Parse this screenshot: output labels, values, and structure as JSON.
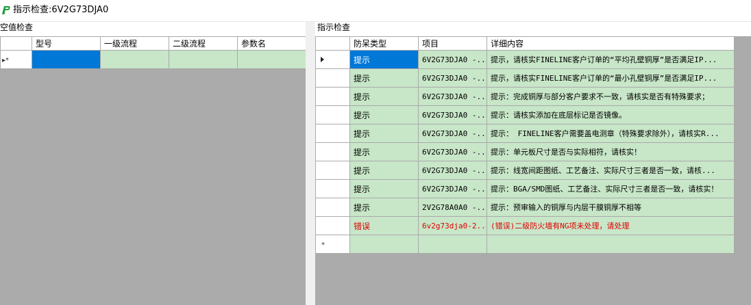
{
  "window": {
    "title": "指示检查:6V2G73DJA0"
  },
  "left_panel": {
    "label": "空值检查",
    "columns": [
      "型号",
      "一级流程",
      "二级流程",
      "参数名"
    ],
    "new_row_marker": "▸*"
  },
  "right_panel": {
    "label": "指示检查",
    "columns": [
      "防呆类型",
      "项目",
      "详细内容"
    ],
    "rows": [
      {
        "type": "提示",
        "item": "6V2G73DJA0 -...",
        "detail": "提示，请核实FINELINE客户订单的“平均孔壁铜厚”是否满足IP...",
        "error": false,
        "selected": true
      },
      {
        "type": "提示",
        "item": "6V2G73DJA0 -...",
        "detail": "提示，请核实FINELINE客户订单的“最小孔壁铜厚”是否满足IP...",
        "error": false,
        "selected": false
      },
      {
        "type": "提示",
        "item": "6V2G73DJA0 -...",
        "detail": "提示：完成铜厚与部分客户要求不一致，请核实是否有特殊要求；",
        "error": false,
        "selected": false
      },
      {
        "type": "提示",
        "item": "6V2G73DJA0 -...",
        "detail": "提示：请核实添加在底层标记是否镜像。",
        "error": false,
        "selected": false
      },
      {
        "type": "提示",
        "item": "6V2G73DJA0 -...",
        "detail": "提示： FINELINE客户需要盖电测章（特殊要求除外），请核实R...",
        "error": false,
        "selected": false
      },
      {
        "type": "提示",
        "item": "6V2G73DJA0 -...",
        "detail": "提示：单元板尺寸是否与实际相符，请核实！",
        "error": false,
        "selected": false
      },
      {
        "type": "提示",
        "item": "6V2G73DJA0 -...",
        "detail": "提示：线宽间距图纸、工艺备注、实际尺寸三者是否一致，请核...",
        "error": false,
        "selected": false
      },
      {
        "type": "提示",
        "item": "6V2G73DJA0 -...",
        "detail": "提示：BGA/SMD图纸、工艺备注、实际尺寸三者是否一致，请核实！",
        "error": false,
        "selected": false
      },
      {
        "type": "提示",
        "item": "2V2G78A0A0 -...",
        "detail": "提示：预审输入的铜厚与内层干膜铜厚不相等",
        "error": false,
        "selected": false
      },
      {
        "type": "错误",
        "item": "6v2g73dja0-2...",
        "detail": "(错误)二级防火墙有NG项未处理，请处理",
        "error": true,
        "selected": false
      }
    ],
    "new_row_marker": "*"
  },
  "colors": {
    "cell_bg": "#c8e6c8",
    "selected_bg": "#0078d7",
    "error_text": "#e00000",
    "empty_area": "#ababab"
  }
}
